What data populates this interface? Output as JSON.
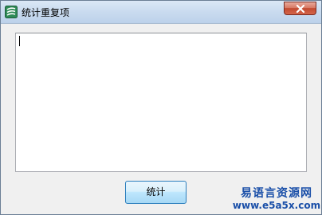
{
  "window": {
    "title": "统计重复项",
    "icon": "app-logo-icon",
    "close_icon": "close-icon"
  },
  "editor": {
    "value": ""
  },
  "buttons": {
    "stat_label": "统计"
  },
  "watermark": {
    "name": "易语言资源网",
    "url": "www.e5a5x.com"
  }
}
